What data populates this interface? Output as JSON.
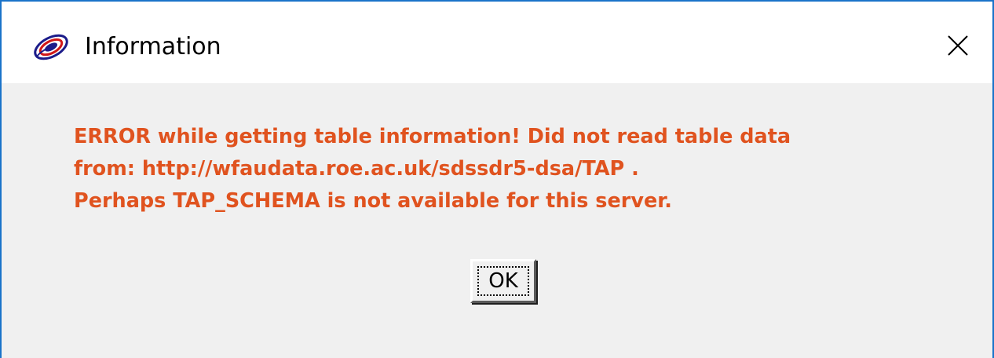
{
  "window": {
    "title": "Information",
    "app_icon": "java-swing-app-icon",
    "close_icon": "close-icon",
    "border_color": "#1a73c9"
  },
  "message": {
    "color": "#e0531f",
    "lines": [
      "ERROR while getting table information! Did not read table data",
      "from: http://wfaudata.roe.ac.uk/sdssdr5-dsa/TAP .",
      "Perhaps TAP_SCHEMA is not available for this server."
    ]
  },
  "buttons": {
    "ok_label": "OK"
  }
}
